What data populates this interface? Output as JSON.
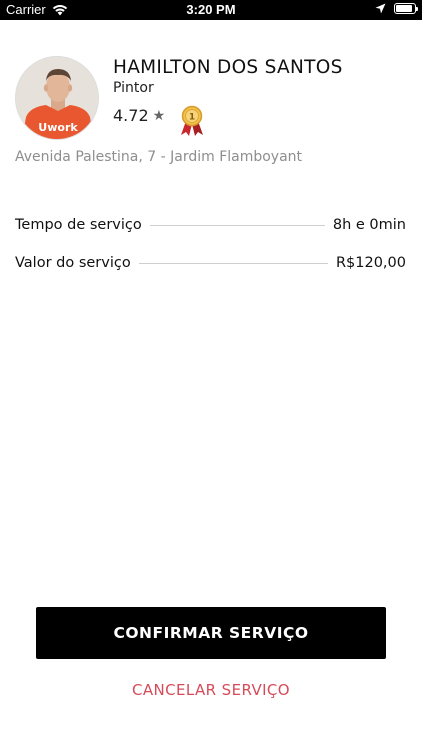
{
  "status_bar": {
    "carrier": "Carrier",
    "time": "3:20 PM",
    "battery_level": 0.9
  },
  "profile": {
    "name": "HAMILTON DOS SANTOS",
    "role": "Pintor",
    "rating": "4.72",
    "star_icon": "★",
    "avatar_shirt_text": "Uwork",
    "medal_rank": "1"
  },
  "address": "Avenida Palestina, 7 - Jardim Flamboyant",
  "details": [
    {
      "label": "Tempo de serviço",
      "value": "8h e 0min"
    },
    {
      "label": "Valor do serviço",
      "value": "R$120,00"
    }
  ],
  "actions": {
    "confirm_label": "CONFIRMAR SERVIÇO",
    "cancel_label": "CANCELAR SERVIÇO"
  },
  "colors": {
    "primary": "#000000",
    "cancel": "#d64b5a",
    "muted": "#8e8e8e",
    "shirt": "#e8572f"
  }
}
